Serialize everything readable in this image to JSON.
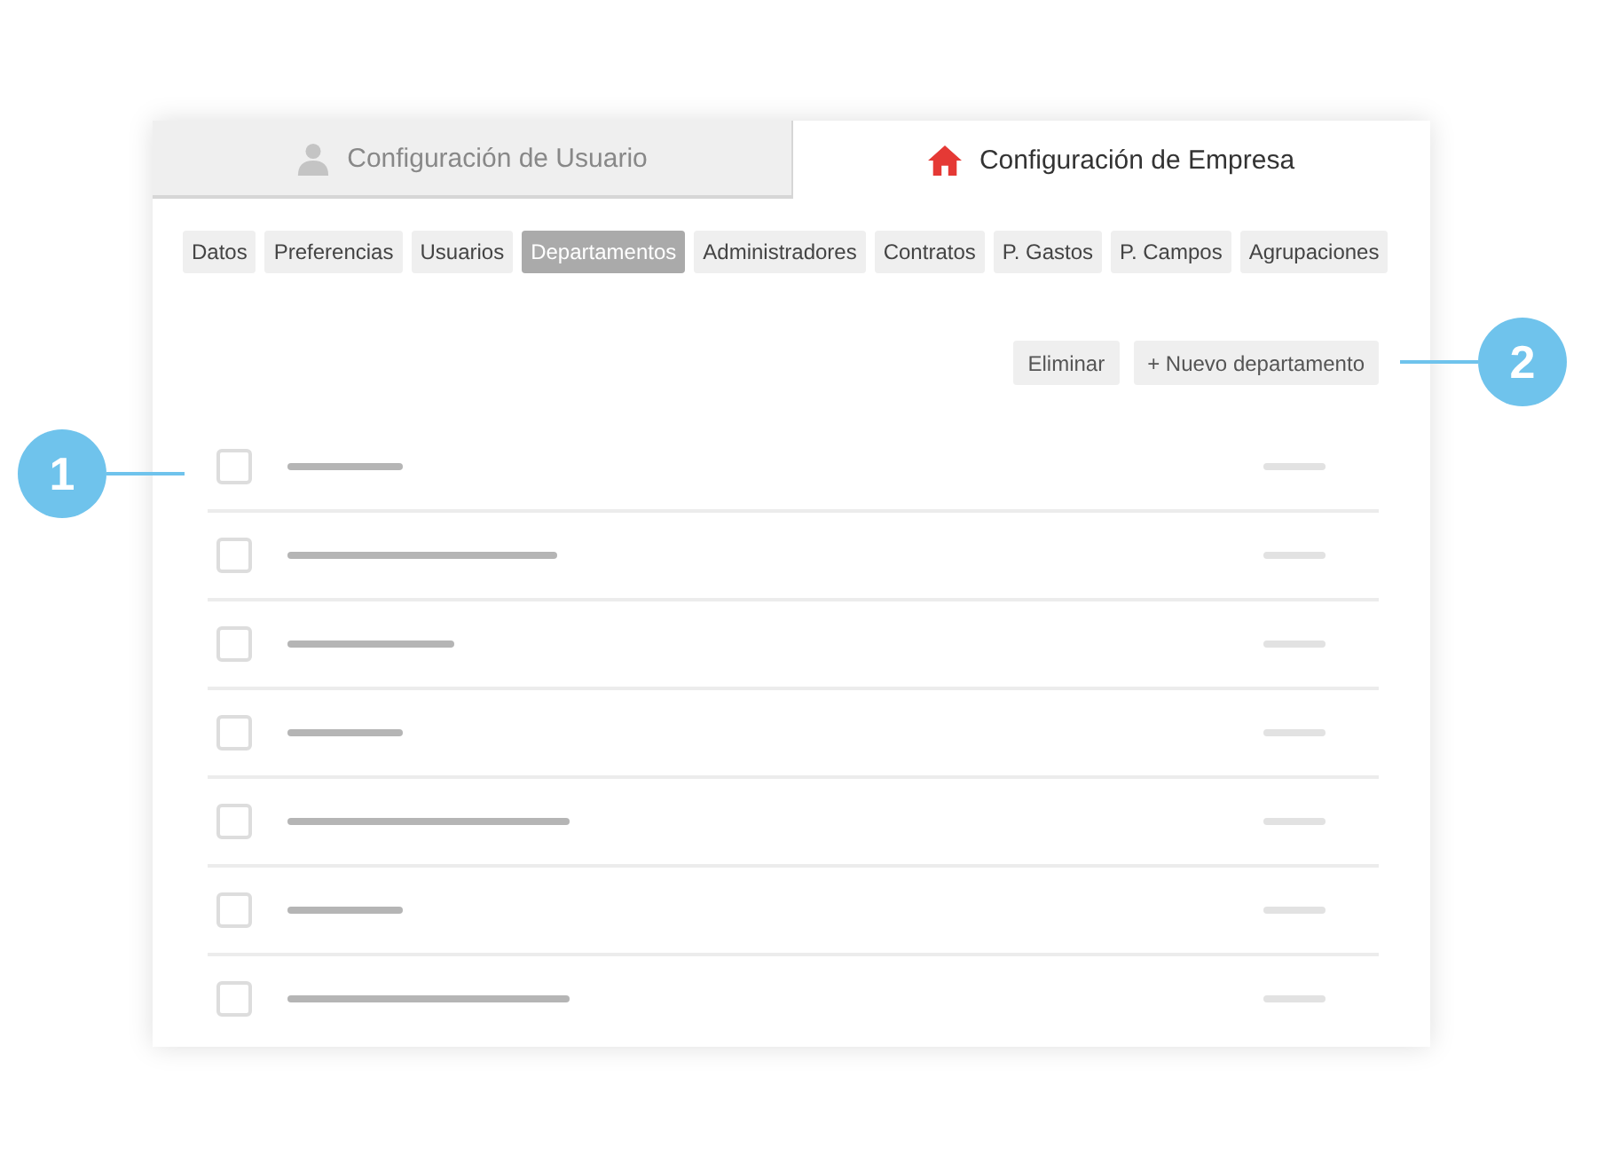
{
  "main_tabs": [
    {
      "label": "Configuración de Usuario",
      "kind": "person",
      "selected": false
    },
    {
      "label": "Configuración de Empresa",
      "kind": "house",
      "selected": true
    }
  ],
  "sub_tabs": [
    {
      "label": "Datos",
      "selected": false
    },
    {
      "label": "Preferencias",
      "selected": false
    },
    {
      "label": "Usuarios",
      "selected": false
    },
    {
      "label": "Departamentos",
      "selected": true
    },
    {
      "label": "Administradores",
      "selected": false
    },
    {
      "label": "Contratos",
      "selected": false
    },
    {
      "label": "P. Gastos",
      "selected": false
    },
    {
      "label": "P. Campos",
      "selected": false
    },
    {
      "label": "Agrupaciones",
      "selected": false
    }
  ],
  "actions": [
    "Eliminar",
    "+ Nuevo departamento"
  ],
  "rows": [
    {
      "checked": false
    },
    {
      "checked": false
    },
    {
      "checked": false
    },
    {
      "checked": false
    },
    {
      "checked": false
    },
    {
      "checked": false
    },
    {
      "checked": false
    }
  ],
  "callouts": [
    {
      "number": "1",
      "kind": "left"
    },
    {
      "number": "2",
      "kind": "right"
    }
  ]
}
